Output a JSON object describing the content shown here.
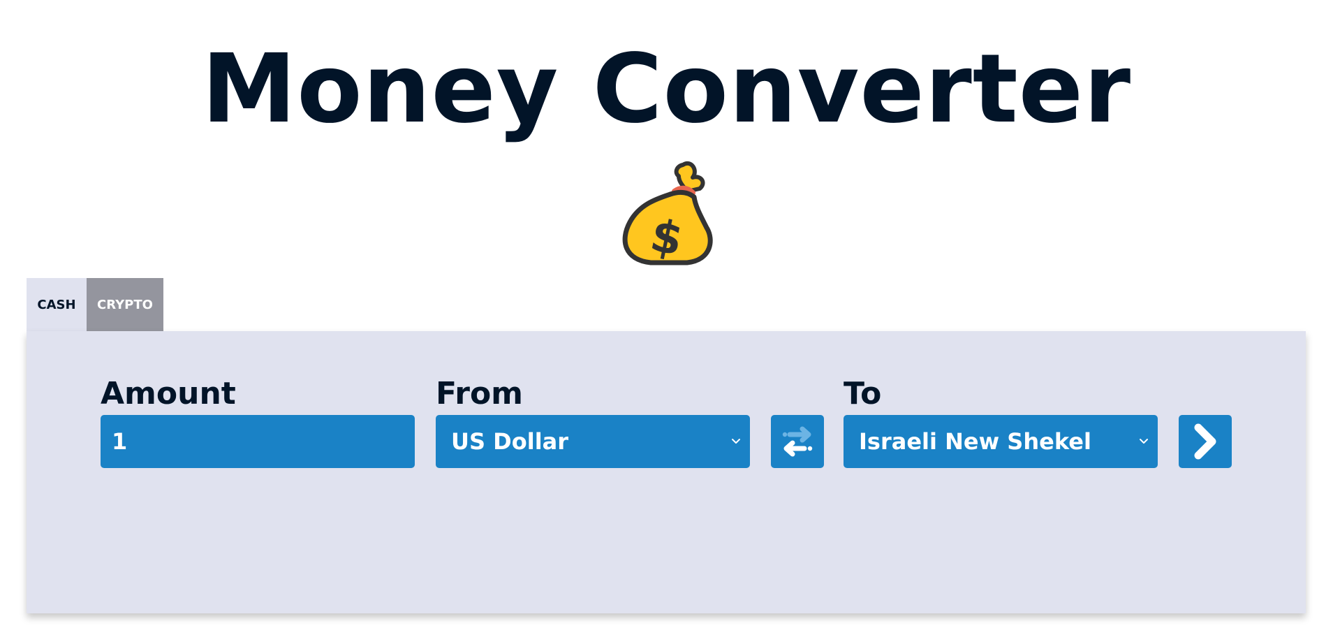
{
  "header": {
    "title": "Money Converter",
    "logo_icon": "money-bag-icon"
  },
  "tabs": [
    {
      "label": "CASH",
      "active": true
    },
    {
      "label": "CRYPTO",
      "active": false
    }
  ],
  "form": {
    "amount": {
      "label": "Amount",
      "value": "1"
    },
    "from": {
      "label": "From",
      "selected": "US Dollar"
    },
    "swap": {
      "icon": "swap-arrows-icon"
    },
    "to": {
      "label": "To",
      "selected": "Israeli New Shekel"
    },
    "convert": {
      "icon": "chevron-right-icon"
    }
  },
  "colors": {
    "primary": "#1a82c6",
    "panel_background": "#e0e2ef",
    "text_dark": "#021428",
    "tab_inactive": "#94959e"
  }
}
